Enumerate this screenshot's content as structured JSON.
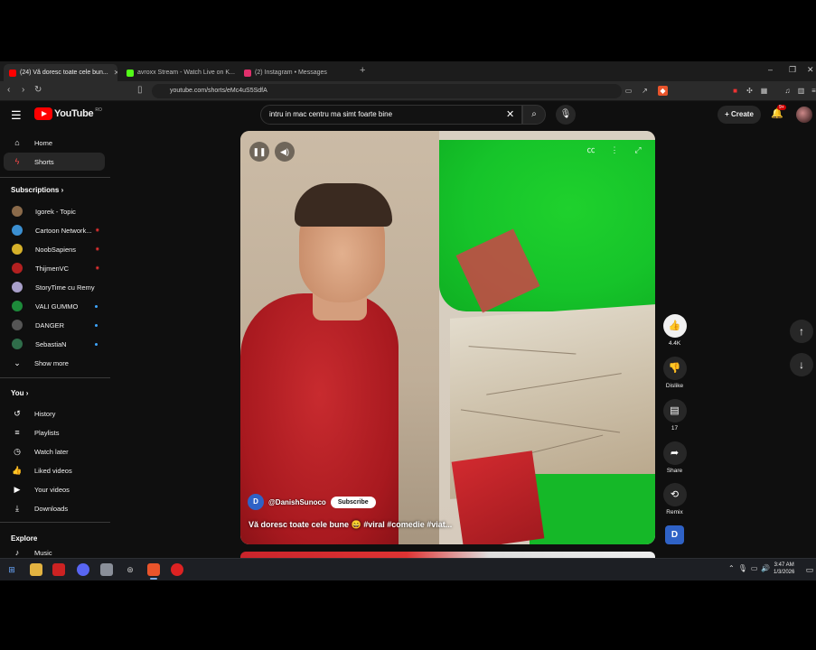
{
  "browser": {
    "tabs": [
      {
        "title": "(24) Vă doresc toate cele bun...",
        "active": true,
        "favicon_color": "#ff0000"
      },
      {
        "title": "avroxx Stream - Watch Live on K...",
        "active": false,
        "favicon_color": "#53fc18"
      },
      {
        "title": "(2) Instagram • Messages",
        "active": false,
        "favicon_color": "#e1306c"
      }
    ],
    "new_tab_icon": "+",
    "url": "youtube.com/shorts/eMc4uS5SdfA"
  },
  "youtube": {
    "logo_text": "YouTube",
    "logo_region": "RO",
    "search_value": "intru in mac centru ma simt foarte bine",
    "create_label": "Create",
    "notification_count": "9+"
  },
  "sidebar": {
    "main": [
      {
        "label": "Home",
        "icon": "home-icon",
        "glyph": "⌂"
      },
      {
        "label": "Shorts",
        "icon": "shorts-icon",
        "glyph": "⚡",
        "selected": true
      }
    ],
    "subscriptions_title": "Subscriptions",
    "subscriptions": [
      {
        "label": "Igorek - Topic",
        "color": "#8a6a4a"
      },
      {
        "label": "Cartoon Network...",
        "color": "#3b8fd1",
        "live": true
      },
      {
        "label": "NoobSapiens",
        "color": "#d6b12a",
        "live": true
      },
      {
        "label": "ThijmenVC",
        "color": "#b32020",
        "live": true
      },
      {
        "label": "StoryTime cu Remy",
        "color": "#a89fc9"
      },
      {
        "label": "VALI GUMMO",
        "color": "#1d8a3a",
        "dot": true
      },
      {
        "label": "DANGER",
        "color": "#555555",
        "dot": true
      },
      {
        "label": "SebastiaN",
        "color": "#2f6d4a",
        "dot": true
      }
    ],
    "show_more": "Show more",
    "you_title": "You",
    "you": [
      {
        "label": "History",
        "glyph": "↺"
      },
      {
        "label": "Playlists",
        "glyph": "≡"
      },
      {
        "label": "Watch later",
        "glyph": "◷"
      },
      {
        "label": "Liked videos",
        "glyph": "👍"
      },
      {
        "label": "Your videos",
        "glyph": "▶"
      },
      {
        "label": "Downloads",
        "glyph": "⤓"
      }
    ],
    "explore_title": "Explore",
    "explore": [
      {
        "label": "Music",
        "glyph": "♪"
      }
    ]
  },
  "short": {
    "channel_initial": "D",
    "channel_name": "@DanishSunoco",
    "subscribe_label": "Subscribe",
    "title": "Vă doresc toate cele bune 😄 #viral #comedie #viat...",
    "controls": {
      "pause": "pause-icon",
      "volume": "volume-icon",
      "captions": "captions-icon",
      "more": "more-icon",
      "fullscreen": "fullscreen-icon"
    }
  },
  "actions": {
    "like_count": "4.4K",
    "dislike_label": "Dislike",
    "comment_count": "17",
    "share_label": "Share",
    "remix_label": "Remix",
    "channel_initial": "D"
  },
  "taskbar": {
    "time": "3:47 AM",
    "date": "1/3/2026"
  }
}
